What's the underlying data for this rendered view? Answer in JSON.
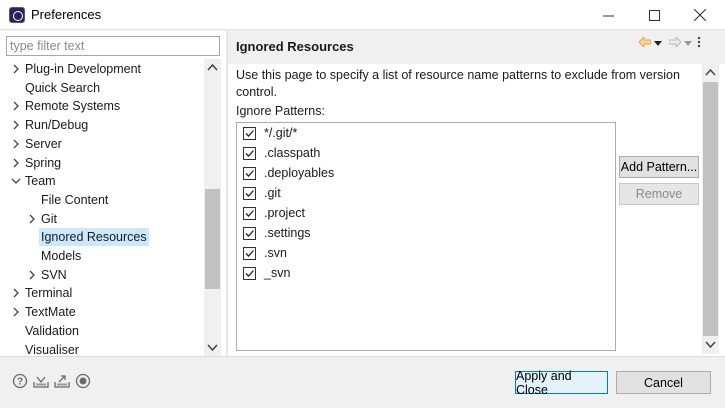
{
  "window": {
    "title": "Preferences",
    "minimize_icon": "minimize-icon",
    "maximize_icon": "maximize-icon",
    "close_icon": "close-icon"
  },
  "filter": {
    "placeholder": "type filter text",
    "value": ""
  },
  "tree": {
    "items": [
      {
        "label": "Plug-in Development",
        "level": 0,
        "expander": "collapsed"
      },
      {
        "label": "Quick Search",
        "level": 0,
        "expander": "none"
      },
      {
        "label": "Remote Systems",
        "level": 0,
        "expander": "collapsed"
      },
      {
        "label": "Run/Debug",
        "level": 0,
        "expander": "collapsed"
      },
      {
        "label": "Server",
        "level": 0,
        "expander": "collapsed"
      },
      {
        "label": "Spring",
        "level": 0,
        "expander": "collapsed"
      },
      {
        "label": "Team",
        "level": 0,
        "expander": "expanded"
      },
      {
        "label": "File Content",
        "level": 1,
        "expander": "none"
      },
      {
        "label": "Git",
        "level": 1,
        "expander": "collapsed"
      },
      {
        "label": "Ignored Resources",
        "level": 1,
        "expander": "none",
        "selected": true
      },
      {
        "label": "Models",
        "level": 1,
        "expander": "none"
      },
      {
        "label": "SVN",
        "level": 1,
        "expander": "collapsed"
      },
      {
        "label": "Terminal",
        "level": 0,
        "expander": "collapsed"
      },
      {
        "label": "TextMate",
        "level": 0,
        "expander": "collapsed"
      },
      {
        "label": "Validation",
        "level": 0,
        "expander": "none"
      },
      {
        "label": "Visualiser",
        "level": 0,
        "expander": "none"
      }
    ]
  },
  "page": {
    "title": "Ignored Resources",
    "description": "Use this page to specify a list of resource name patterns to exclude from version control.",
    "patterns_label": "Ignore Patterns:",
    "patterns": [
      {
        "pattern": "*/.git/*",
        "checked": true
      },
      {
        "pattern": ".classpath",
        "checked": true
      },
      {
        "pattern": ".deployables",
        "checked": true
      },
      {
        "pattern": ".git",
        "checked": true
      },
      {
        "pattern": ".project",
        "checked": true
      },
      {
        "pattern": ".settings",
        "checked": true
      },
      {
        "pattern": ".svn",
        "checked": true
      },
      {
        "pattern": "_svn",
        "checked": true
      }
    ],
    "add_pattern_label": "Add Pattern...",
    "remove_label": "Remove"
  },
  "footer": {
    "icons": [
      "help-icon",
      "import-icon",
      "export-icon",
      "record-icon"
    ],
    "apply_close_label": "Apply and Close",
    "cancel_label": "Cancel"
  },
  "colors": {
    "selection": "#cce8ff",
    "default_button_border": "#0078d7",
    "nav_back_arrow": "#e8a33b"
  }
}
